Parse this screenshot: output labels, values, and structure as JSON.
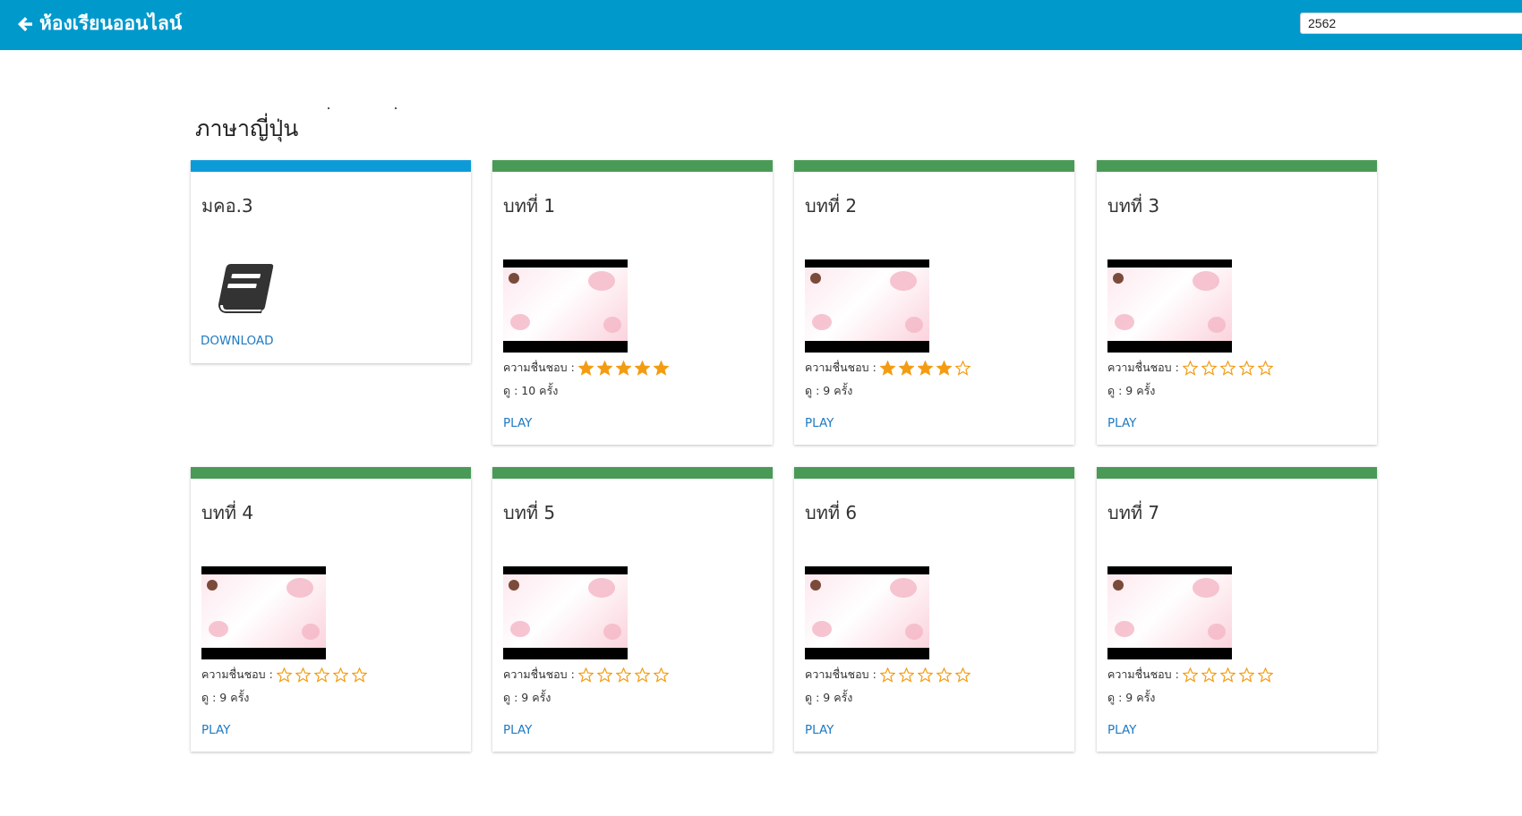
{
  "header": {
    "title": "ห้องเรียนออนไลน์",
    "back_icon": "arrow-left-icon",
    "year_selected": "2562",
    "bg_color": "#0099cc"
  },
  "subject_title": "ภาษาญี่ปุ่น",
  "doc_card": {
    "title": "มคอ.3",
    "icon": "book-icon",
    "link_label": "DOWNLOAD"
  },
  "likes_label": "ความชื่นชอบ :",
  "play_label": "PLAY",
  "lessons": [
    {
      "title": "บทที่ 1",
      "rating": 5,
      "views": "ดู : 10 ครั้ง"
    },
    {
      "title": "บทที่ 2",
      "rating": 4,
      "views": "ดู : 9 ครั้ง"
    },
    {
      "title": "บทที่ 3",
      "rating": 0,
      "views": "ดู : 9 ครั้ง"
    },
    {
      "title": "บทที่ 4",
      "rating": 0,
      "views": "ดู : 9 ครั้ง"
    },
    {
      "title": "บทที่ 5",
      "rating": 0,
      "views": "ดู : 9 ครั้ง"
    },
    {
      "title": "บทที่ 6",
      "rating": 0,
      "views": "ดู : 9 ครั้ง"
    },
    {
      "title": "บทที่ 7",
      "rating": 0,
      "views": "ดู : 9 ครั้ง"
    }
  ],
  "colors": {
    "star": "#f39c12",
    "link": "#1f7ac2",
    "card_bar_blue": "#0d9bd7",
    "card_bar_green": "#4a9a57"
  }
}
